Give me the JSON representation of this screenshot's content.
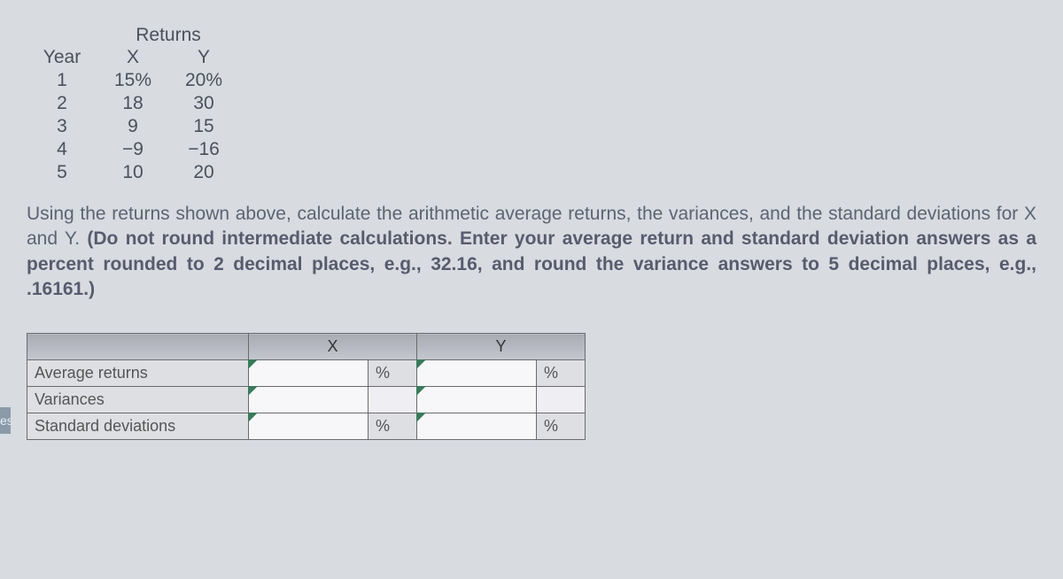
{
  "sidebar": {
    "fragment": "es"
  },
  "data_table": {
    "returns_label": "Returns",
    "headers": {
      "year": "Year",
      "x": "X",
      "y": "Y"
    },
    "rows": [
      {
        "year": "1",
        "x": "15%",
        "y": "20%"
      },
      {
        "year": "2",
        "x": "18",
        "y": "30"
      },
      {
        "year": "3",
        "x": "9",
        "y": "15"
      },
      {
        "year": "4",
        "x": "−9",
        "y": "−16"
      },
      {
        "year": "5",
        "x": "10",
        "y": "20"
      }
    ]
  },
  "instructions": {
    "plain": "Using the returns shown above, calculate the arithmetic average returns, the variances, and the standard deviations for X and Y. ",
    "bold": "(Do not round intermediate calculations. Enter your average return and standard deviation answers as a percent rounded to 2 decimal places, e.g., 32.16, and round the variance answers to 5 decimal places, e.g., .16161.)"
  },
  "answer_table": {
    "col_x": "X",
    "col_y": "Y",
    "rows": [
      {
        "label": "Average returns",
        "x_unit": "%",
        "y_unit": "%"
      },
      {
        "label": "Variances",
        "x_unit": "",
        "y_unit": ""
      },
      {
        "label": "Standard deviations",
        "x_unit": "%",
        "y_unit": "%"
      }
    ]
  }
}
